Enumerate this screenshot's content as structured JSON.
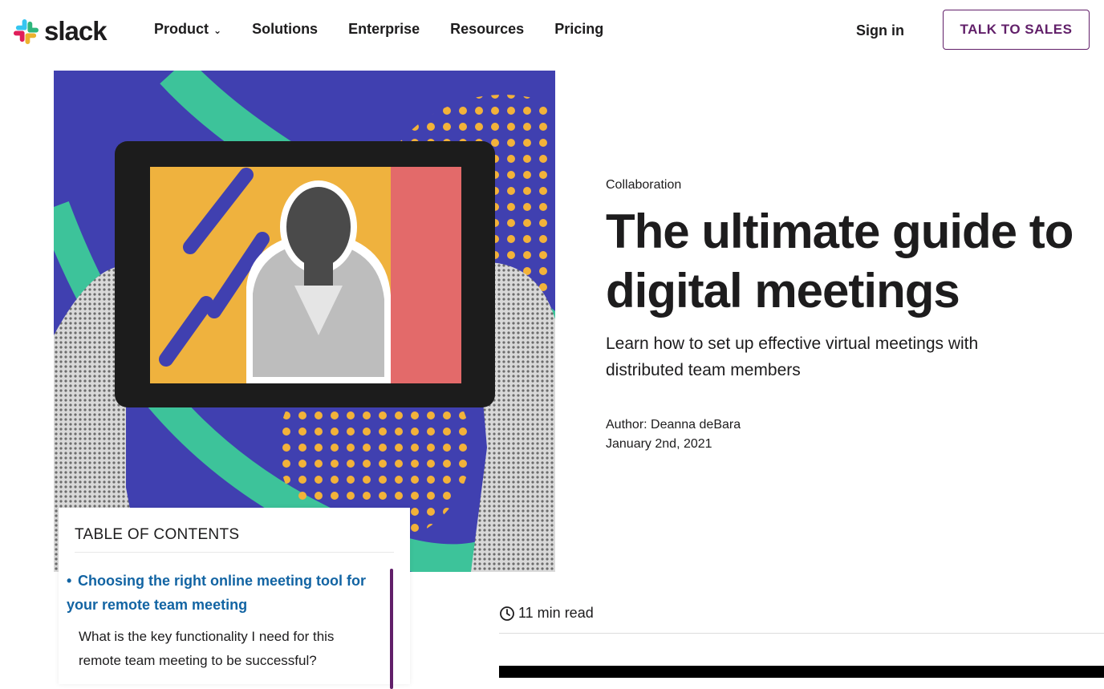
{
  "brand": {
    "name": "slack",
    "colors": {
      "blue": "#36C5F0",
      "green": "#2EB67D",
      "yellow": "#ECB22E",
      "red": "#E01E5A",
      "aubergine": "#611f69",
      "link": "#1264a3"
    }
  },
  "nav": {
    "items": [
      {
        "label": "Product",
        "has_dropdown": true
      },
      {
        "label": "Solutions"
      },
      {
        "label": "Enterprise"
      },
      {
        "label": "Resources"
      },
      {
        "label": "Pricing"
      }
    ],
    "sign_in": "Sign in",
    "cta": "TALK TO SALES"
  },
  "article": {
    "category": "Collaboration",
    "title": "The ultimate guide to digital meetings",
    "subtitle": "Learn how to set up effective virtual meetings with distributed team members",
    "author_line": "Author: Deanna deBara",
    "date": "January 2nd, 2021",
    "read_time": "11 min read"
  },
  "toc": {
    "title": "TABLE OF CONTENTS",
    "active_item": "Choosing the right online meeting tool for your remote team meeting",
    "items": [
      "What is the key functionality I need for this remote team meeting to be successful?"
    ]
  },
  "icons": {
    "chevron": "chevron-down-icon",
    "clock": "clock-icon"
  }
}
